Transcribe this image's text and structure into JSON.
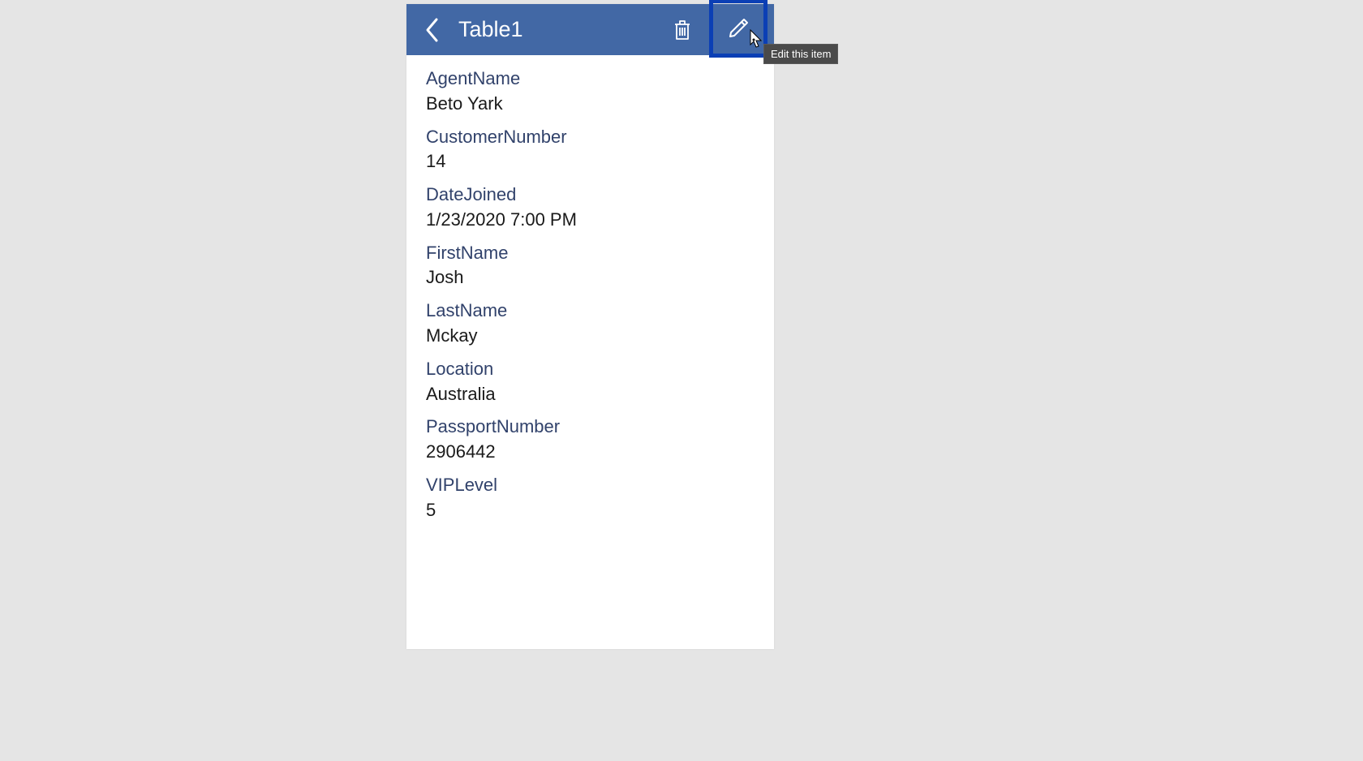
{
  "header": {
    "title": "Table1"
  },
  "tooltip": {
    "edit": "Edit this item"
  },
  "fields": [
    {
      "label": "AgentName",
      "value": "Beto Yark"
    },
    {
      "label": "CustomerNumber",
      "value": "14"
    },
    {
      "label": "DateJoined",
      "value": "1/23/2020 7:00 PM"
    },
    {
      "label": "FirstName",
      "value": "Josh"
    },
    {
      "label": "LastName",
      "value": "Mckay"
    },
    {
      "label": "Location",
      "value": "Australia"
    },
    {
      "label": "PassportNumber",
      "value": "2906442"
    },
    {
      "label": "VIPLevel",
      "value": "5"
    }
  ]
}
